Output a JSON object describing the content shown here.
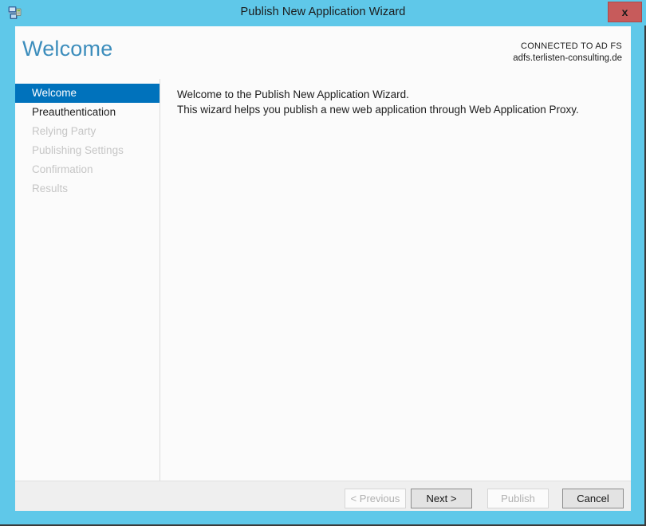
{
  "window": {
    "title": "Publish New Application Wizard",
    "icon": "network-application-icon",
    "close_label": "x",
    "frame_color": "#5fc8e9"
  },
  "header": {
    "page_title": "Welcome",
    "page_title_color": "#3c8dbc",
    "connected_label": "CONNECTED TO AD FS",
    "connected_host": "adfs.terlisten-consulting.de"
  },
  "sidebar": {
    "items": [
      {
        "label": "Welcome",
        "state": "active"
      },
      {
        "label": "Preauthentication",
        "state": "enabled"
      },
      {
        "label": "Relying Party",
        "state": "disabled"
      },
      {
        "label": "Publishing Settings",
        "state": "disabled"
      },
      {
        "label": "Confirmation",
        "state": "disabled"
      },
      {
        "label": "Results",
        "state": "disabled"
      }
    ],
    "active_color": "#0072bc",
    "disabled_color": "#c6c6c6"
  },
  "content": {
    "lines": [
      "Welcome to the Publish New Application Wizard.",
      "This wizard helps you publish a new web application through Web Application Proxy."
    ]
  },
  "footer": {
    "buttons": [
      {
        "label": "< Previous",
        "state": "disabled"
      },
      {
        "label": "Next >",
        "state": "enabled"
      },
      {
        "label": "Publish",
        "state": "disabled"
      },
      {
        "label": "Cancel",
        "state": "enabled"
      }
    ]
  }
}
